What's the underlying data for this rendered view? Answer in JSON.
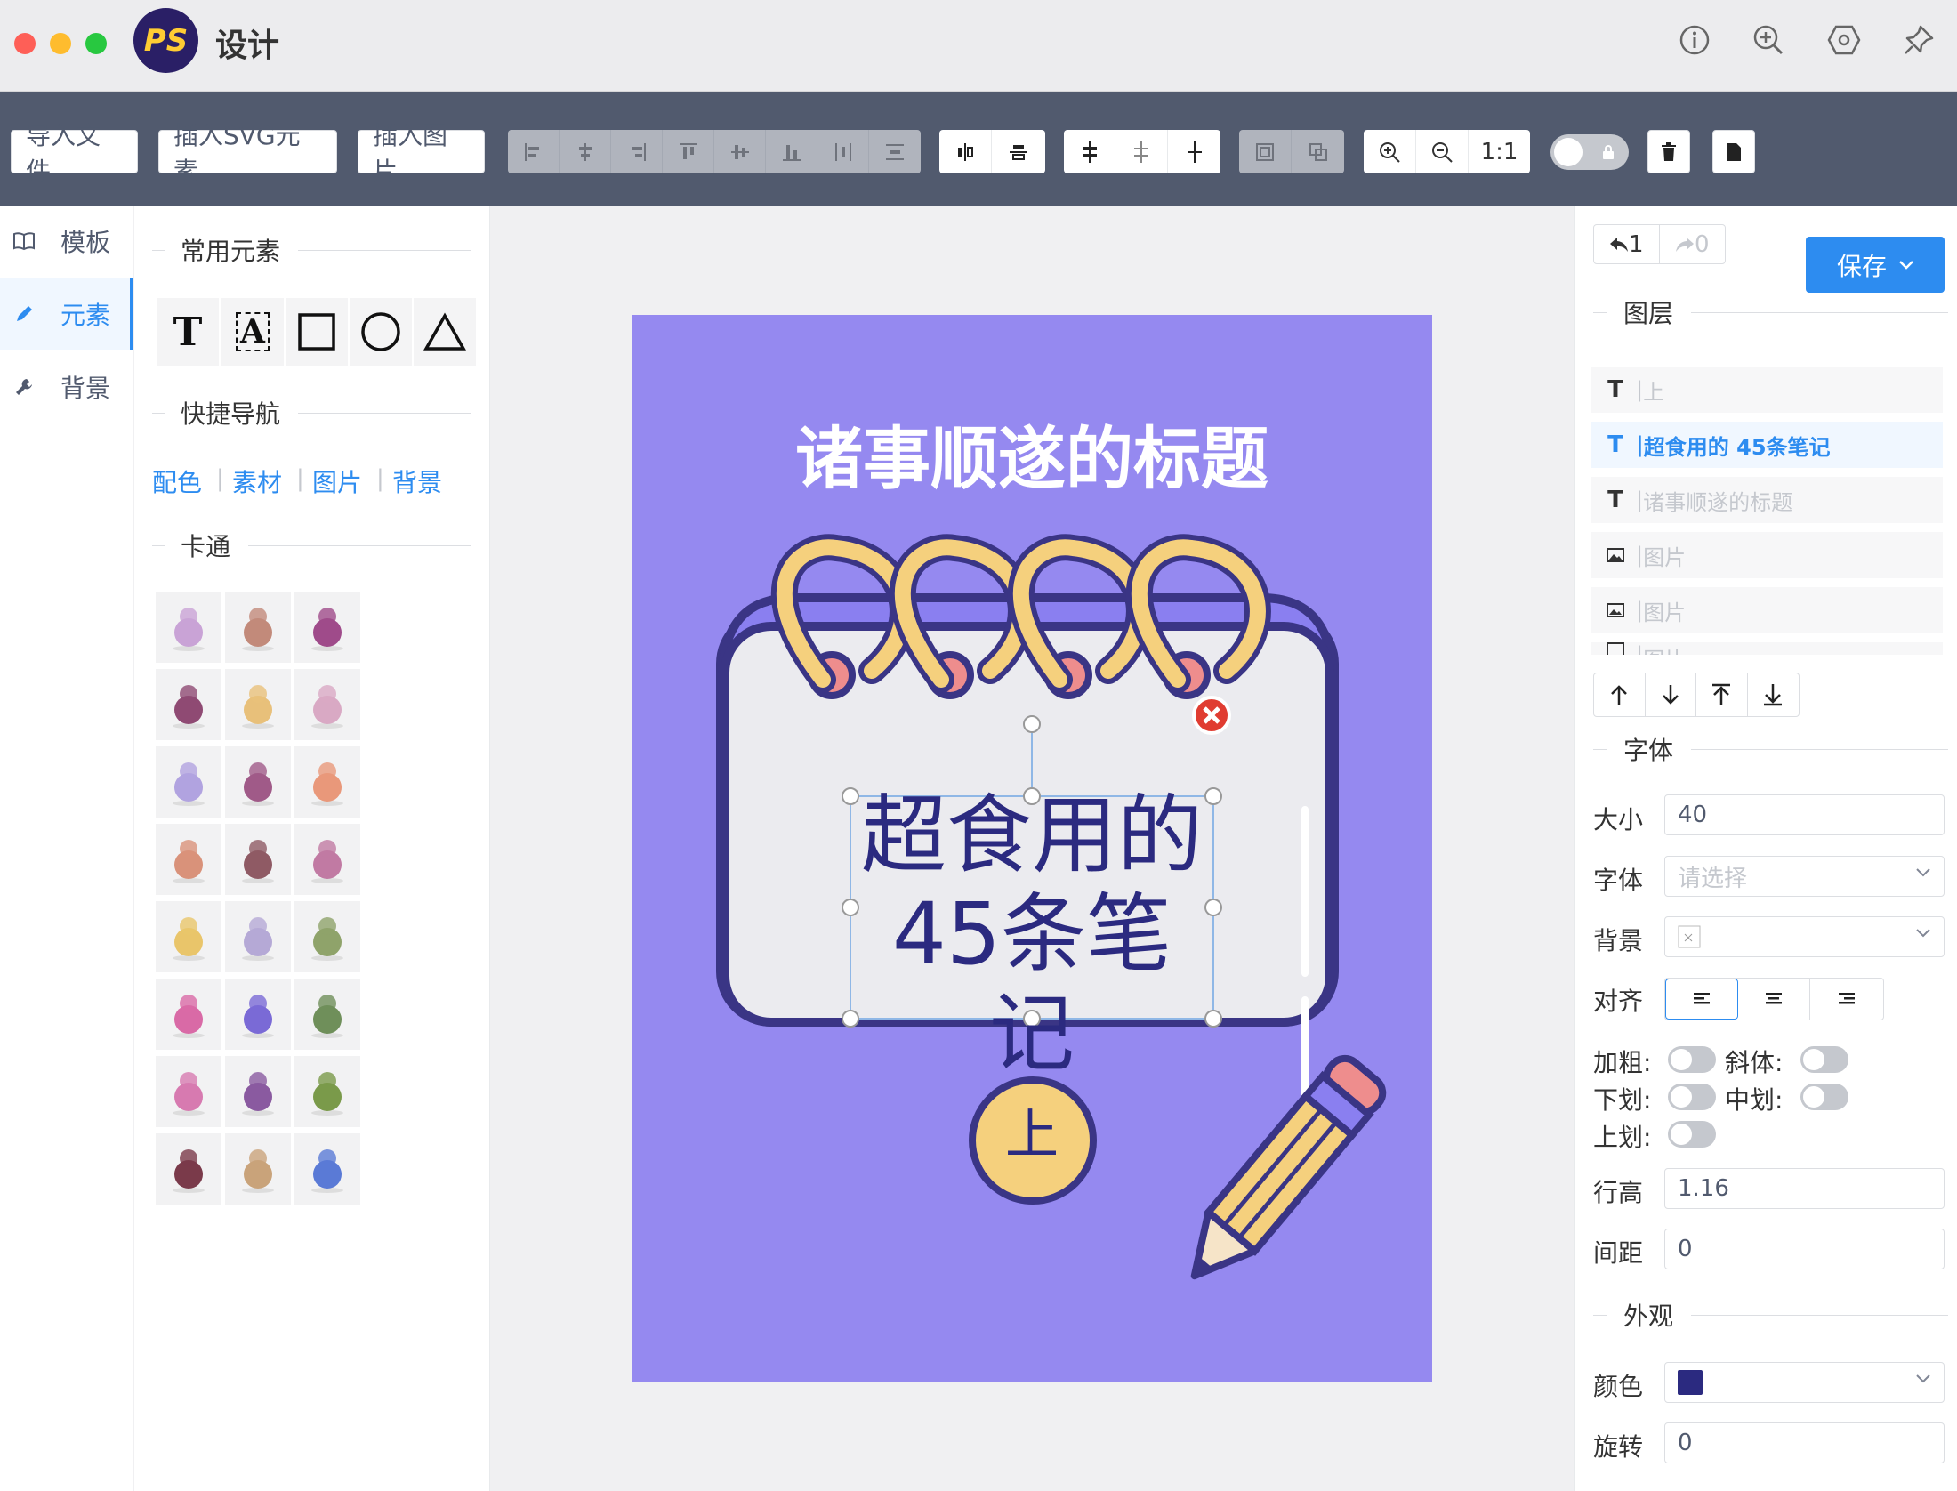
{
  "window": {
    "title": "设计",
    "logo_text": "PS"
  },
  "toolbar": {
    "import_file": "导入文件",
    "insert_svg": "插入SVG元素",
    "insert_image": "插入图片",
    "zoom_reset": "1:1"
  },
  "leftnav": {
    "items": [
      {
        "label": "模板",
        "icon": "book-icon"
      },
      {
        "label": "元素",
        "icon": "pencil-icon"
      },
      {
        "label": "背景",
        "icon": "wrench-icon"
      }
    ]
  },
  "elements_panel": {
    "common_title": "常用元素",
    "shapes": [
      "T",
      "A"
    ],
    "quicknav_title": "快捷导航",
    "quicknav_links": [
      "配色",
      "素材",
      "图片",
      "背景"
    ],
    "category_title": "卡通",
    "tiles": [
      "bow-icon",
      "centaur-icon",
      "armor-icon",
      "dragon-egg-icon",
      "elf-icon",
      "treasure-map-icon",
      "fairy-icon",
      "crystal-icon",
      "meat-icon",
      "coin-bag-icon",
      "reaper-icon",
      "knight-helmet-icon",
      "king-icon",
      "paladin-icon",
      "medusa-icon",
      "dragon-icon",
      "spider-icon",
      "orc-icon",
      "potion-icon",
      "witch-icon",
      "tree-icon",
      "spellbook-icon",
      "viking-icon",
      "sword-icon"
    ]
  },
  "poster": {
    "title": "诸事顺遂的标题",
    "body": [
      "超食用的",
      "45条笔记"
    ],
    "tag": "上"
  },
  "right": {
    "undo_count": "1",
    "redo_count": "0",
    "save": "保存",
    "layers_title": "图层",
    "layers": [
      {
        "label": "上"
      },
      {
        "label": "超食用的 45条笔记"
      },
      {
        "label": "诸事顺遂的标题"
      },
      {
        "label": "图片"
      },
      {
        "label": "图片"
      },
      {
        "label": "图片"
      }
    ],
    "font_title": "字体",
    "size_label": "大小",
    "size_value": "40",
    "family_label": "字体",
    "family_placeholder": "请选择",
    "bg_label": "背景",
    "align_label": "对齐",
    "bold_label": "加粗:",
    "italic_label": "斜体:",
    "underline_label": "下划:",
    "strike_label": "中划:",
    "overline_label": "上划:",
    "line_height_label": "行高",
    "line_height_value": "1.16",
    "spacing_label": "间距",
    "spacing_value": "0",
    "appearance_title": "外观",
    "color_label": "颜色",
    "color_value": "#2b2a80",
    "rotate_label": "旋转",
    "rotate_value": "0"
  },
  "colors": {
    "accent": "#2d8cf0",
    "toolbar": "#515a6e",
    "poster_bg": "#9589f0",
    "text_dark": "#2b2a80"
  }
}
